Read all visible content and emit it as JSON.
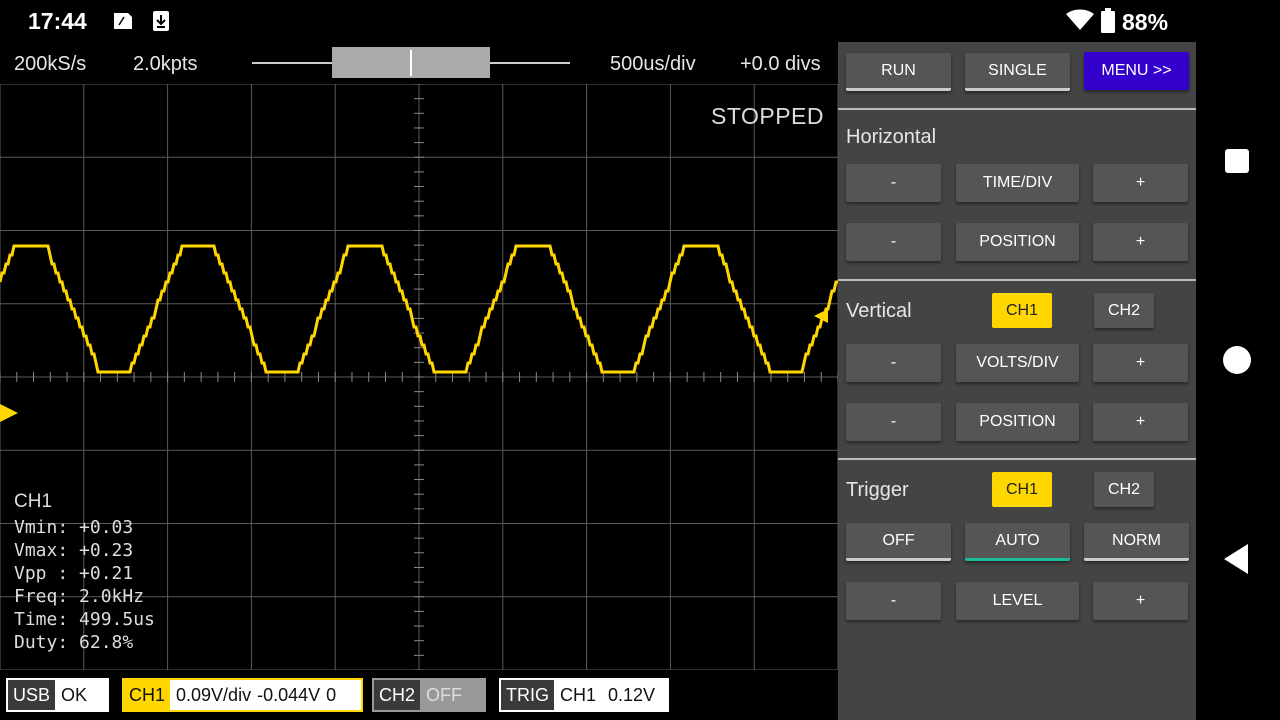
{
  "status_bar": {
    "time": "17:44",
    "battery": "88%"
  },
  "acq": {
    "sample_rate": "200kS/s",
    "points": "2.0kpts",
    "timebase": "500us/div",
    "h_offset": "+0.0 divs",
    "state": "STOPPED"
  },
  "measurements": {
    "channel": "CH1",
    "lines": [
      "Vmin: +0.03",
      "Vmax: +0.23",
      "Vpp : +0.21",
      "Freq: 2.0kHz",
      "Time: 499.5us",
      "Duty: 62.8%"
    ]
  },
  "bottom": {
    "usb": {
      "label": "USB",
      "value": "OK"
    },
    "ch1": {
      "label": "CH1",
      "volts": "0.09V/div",
      "offset": "-0.044V",
      "coupling": "0"
    },
    "ch2": {
      "label": "CH2",
      "value": "OFF"
    },
    "trig": {
      "label": "TRIG",
      "source": "CH1",
      "level": "0.12V"
    }
  },
  "panel": {
    "run": "RUN",
    "single": "SINGLE",
    "menu": "MENU >>",
    "horizontal": {
      "title": "Horizontal",
      "minus": "-",
      "plus": "+",
      "time_div": "TIME/DIV",
      "position": "POSITION"
    },
    "vertical": {
      "title": "Vertical",
      "ch1": "CH1",
      "ch2": "CH2",
      "volts_div": "VOLTS/DIV",
      "position": "POSITION"
    },
    "trigger": {
      "title": "Trigger",
      "ch1": "CH1",
      "ch2": "CH2",
      "off": "OFF",
      "auto": "AUTO",
      "norm": "NORM",
      "level": "LEVEL"
    }
  },
  "colors": {
    "trace": "#ffd700",
    "menu_button": "#3300cc",
    "selected": "#ffd700",
    "auto_underline": "#1abc9c",
    "panel_bg": "#444444"
  },
  "icons": [
    "sim-card-icon",
    "download-icon",
    "wifi-icon",
    "battery-icon",
    "square-nav-icon",
    "home-nav-icon",
    "back-nav-icon"
  ]
}
